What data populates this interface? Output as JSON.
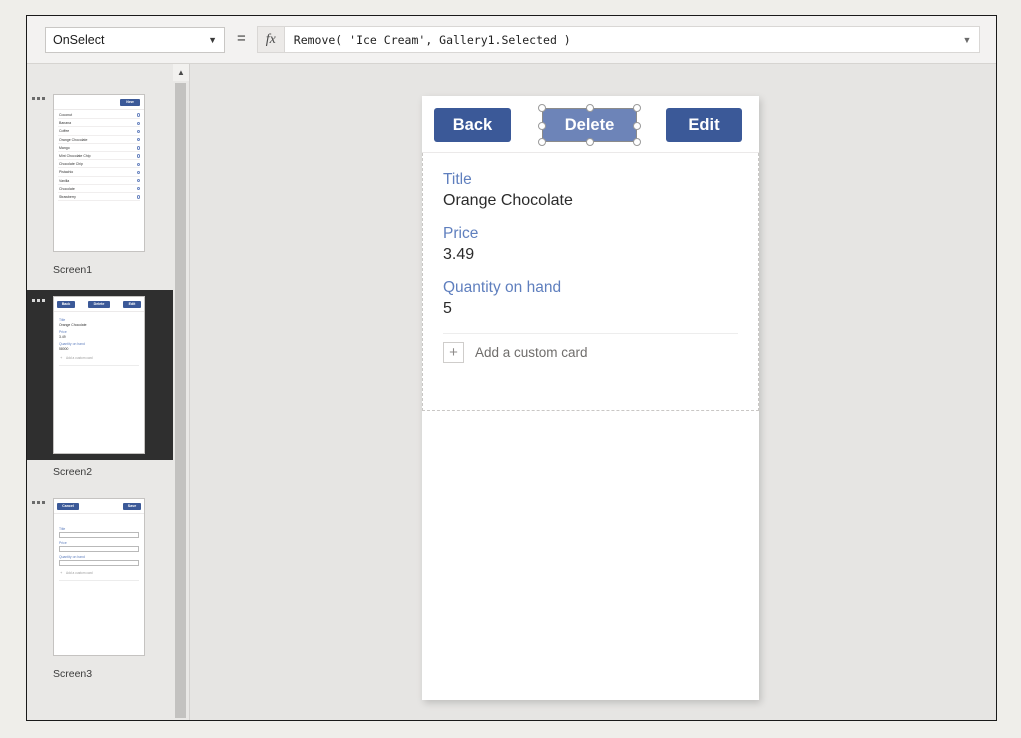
{
  "formula_bar": {
    "property_selected": "OnSelect",
    "property_options": [
      "OnSelect"
    ],
    "equals": "=",
    "fx_icon": "fx-icon",
    "formula": "Remove( 'Ice Cream', Gallery1.Selected )",
    "expand_icon": "chevron-down-icon"
  },
  "screens": [
    {
      "caption": "Screen1",
      "selected": false,
      "type": "gallery",
      "new_button": "New",
      "items": [
        "Coconut",
        "Banana",
        "Coffee",
        "Orange Chocolate",
        "Mango",
        "Mint Chocolate Chip",
        "Chocolate Chip",
        "Pistachio",
        "Vanilla",
        "Chocolate",
        "Strawberry"
      ]
    },
    {
      "caption": "Screen2",
      "selected": true,
      "type": "detail",
      "buttons": [
        "Back",
        "Delete",
        "Edit"
      ],
      "fields": [
        {
          "label": "Title",
          "value": "Orange Chocolate"
        },
        {
          "label": "Price",
          "value": "3.49"
        },
        {
          "label": "Quantity on hand",
          "value": "58000"
        }
      ],
      "add_card": "Add a custom card"
    },
    {
      "caption": "Screen3",
      "selected": false,
      "type": "edit",
      "buttons": [
        "Cancel",
        "Save"
      ],
      "fields": [
        {
          "label": "Title",
          "value": ""
        },
        {
          "label": "Price",
          "value": ""
        },
        {
          "label": "Quantity on hand",
          "value": ""
        }
      ],
      "add_card": "Add a custom card"
    }
  ],
  "canvas": {
    "buttons": {
      "back": "Back",
      "delete": "Delete",
      "edit": "Edit"
    },
    "selected_control": "Delete",
    "form": {
      "fields": [
        {
          "label": "Title",
          "value": "Orange Chocolate"
        },
        {
          "label": "Price",
          "value": "3.49"
        },
        {
          "label": "Quantity on hand",
          "value": "5"
        }
      ],
      "add_card_label": "Add a custom card",
      "add_card_plus": "+"
    }
  },
  "colors": {
    "button_primary": "#3b5998",
    "button_selected": "#6d84b8",
    "field_label": "#5f7fbe",
    "panel_bg": "#e9e8e6",
    "canvas_bg": "#e6e5e3",
    "selected_screen_bg": "#2f2f2f"
  }
}
